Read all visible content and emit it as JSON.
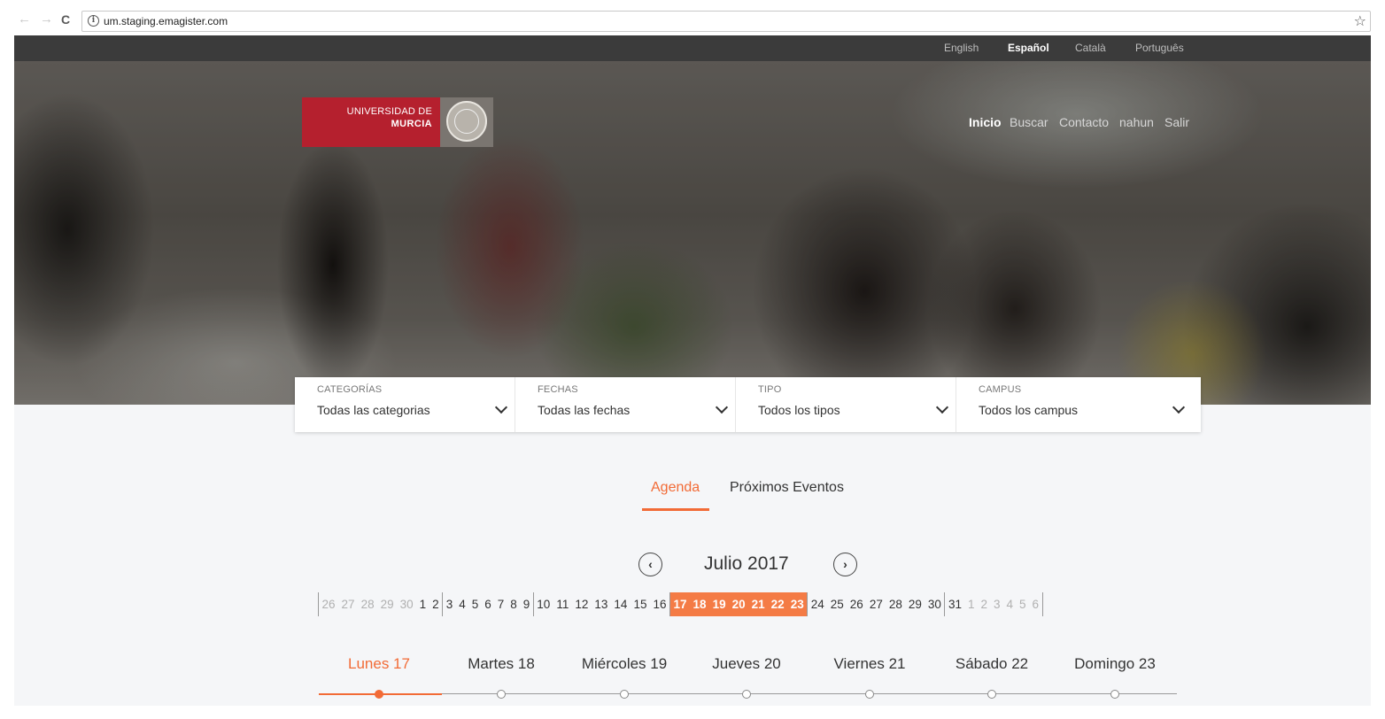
{
  "browser": {
    "url": "um.staging.emagister.com"
  },
  "languages": [
    "English",
    "Español",
    "Català",
    "Português"
  ],
  "active_language": "Español",
  "logo": {
    "line1": "UNIVERSIDAD DE",
    "line2": "MURCIA"
  },
  "main_nav": [
    "Inicio",
    "Buscar",
    "Contacto",
    "nahun",
    "Salir"
  ],
  "filters": [
    {
      "label": "CATEGORÍAS",
      "value": "Todas las categorias"
    },
    {
      "label": "FECHAS",
      "value": "Todas las fechas"
    },
    {
      "label": "TIPO",
      "value": "Todos los tipos"
    },
    {
      "label": "CAMPUS",
      "value": "Todos los campus"
    }
  ],
  "tabs": {
    "agenda": "Agenda",
    "upcoming": "Próximos Eventos"
  },
  "calendar": {
    "month_label": "Julio 2017",
    "prev_icon": "chevron-left-icon",
    "next_icon": "chevron-right-icon"
  },
  "week_days": [
    "Lunes 17",
    "Martes 18",
    "Miércoles 19",
    "Jueves 20",
    "Viernes 21",
    "Sábado 22",
    "Domingo 23"
  ],
  "colors": {
    "accent": "#f26b36",
    "brand_red": "#b5202e",
    "lang_bar": "#3b3b3b"
  }
}
